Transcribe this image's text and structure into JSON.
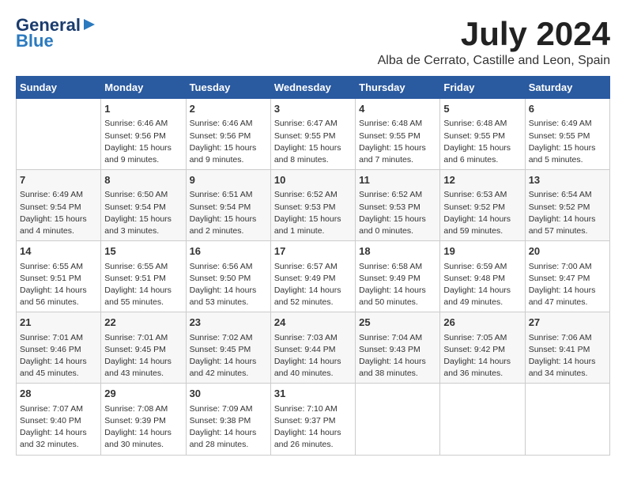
{
  "header": {
    "logo_line1": "General",
    "logo_line2": "Blue",
    "month_year": "July 2024",
    "location": "Alba de Cerrato, Castille and Leon, Spain"
  },
  "days_of_week": [
    "Sunday",
    "Monday",
    "Tuesday",
    "Wednesday",
    "Thursday",
    "Friday",
    "Saturday"
  ],
  "weeks": [
    [
      {
        "day": "",
        "content": ""
      },
      {
        "day": "1",
        "content": "Sunrise: 6:46 AM\nSunset: 9:56 PM\nDaylight: 15 hours\nand 9 minutes."
      },
      {
        "day": "2",
        "content": "Sunrise: 6:46 AM\nSunset: 9:56 PM\nDaylight: 15 hours\nand 9 minutes."
      },
      {
        "day": "3",
        "content": "Sunrise: 6:47 AM\nSunset: 9:55 PM\nDaylight: 15 hours\nand 8 minutes."
      },
      {
        "day": "4",
        "content": "Sunrise: 6:48 AM\nSunset: 9:55 PM\nDaylight: 15 hours\nand 7 minutes."
      },
      {
        "day": "5",
        "content": "Sunrise: 6:48 AM\nSunset: 9:55 PM\nDaylight: 15 hours\nand 6 minutes."
      },
      {
        "day": "6",
        "content": "Sunrise: 6:49 AM\nSunset: 9:55 PM\nDaylight: 15 hours\nand 5 minutes."
      }
    ],
    [
      {
        "day": "7",
        "content": "Sunrise: 6:49 AM\nSunset: 9:54 PM\nDaylight: 15 hours\nand 4 minutes."
      },
      {
        "day": "8",
        "content": "Sunrise: 6:50 AM\nSunset: 9:54 PM\nDaylight: 15 hours\nand 3 minutes."
      },
      {
        "day": "9",
        "content": "Sunrise: 6:51 AM\nSunset: 9:54 PM\nDaylight: 15 hours\nand 2 minutes."
      },
      {
        "day": "10",
        "content": "Sunrise: 6:52 AM\nSunset: 9:53 PM\nDaylight: 15 hours\nand 1 minute."
      },
      {
        "day": "11",
        "content": "Sunrise: 6:52 AM\nSunset: 9:53 PM\nDaylight: 15 hours\nand 0 minutes."
      },
      {
        "day": "12",
        "content": "Sunrise: 6:53 AM\nSunset: 9:52 PM\nDaylight: 14 hours\nand 59 minutes."
      },
      {
        "day": "13",
        "content": "Sunrise: 6:54 AM\nSunset: 9:52 PM\nDaylight: 14 hours\nand 57 minutes."
      }
    ],
    [
      {
        "day": "14",
        "content": "Sunrise: 6:55 AM\nSunset: 9:51 PM\nDaylight: 14 hours\nand 56 minutes."
      },
      {
        "day": "15",
        "content": "Sunrise: 6:55 AM\nSunset: 9:51 PM\nDaylight: 14 hours\nand 55 minutes."
      },
      {
        "day": "16",
        "content": "Sunrise: 6:56 AM\nSunset: 9:50 PM\nDaylight: 14 hours\nand 53 minutes."
      },
      {
        "day": "17",
        "content": "Sunrise: 6:57 AM\nSunset: 9:49 PM\nDaylight: 14 hours\nand 52 minutes."
      },
      {
        "day": "18",
        "content": "Sunrise: 6:58 AM\nSunset: 9:49 PM\nDaylight: 14 hours\nand 50 minutes."
      },
      {
        "day": "19",
        "content": "Sunrise: 6:59 AM\nSunset: 9:48 PM\nDaylight: 14 hours\nand 49 minutes."
      },
      {
        "day": "20",
        "content": "Sunrise: 7:00 AM\nSunset: 9:47 PM\nDaylight: 14 hours\nand 47 minutes."
      }
    ],
    [
      {
        "day": "21",
        "content": "Sunrise: 7:01 AM\nSunset: 9:46 PM\nDaylight: 14 hours\nand 45 minutes."
      },
      {
        "day": "22",
        "content": "Sunrise: 7:01 AM\nSunset: 9:45 PM\nDaylight: 14 hours\nand 43 minutes."
      },
      {
        "day": "23",
        "content": "Sunrise: 7:02 AM\nSunset: 9:45 PM\nDaylight: 14 hours\nand 42 minutes."
      },
      {
        "day": "24",
        "content": "Sunrise: 7:03 AM\nSunset: 9:44 PM\nDaylight: 14 hours\nand 40 minutes."
      },
      {
        "day": "25",
        "content": "Sunrise: 7:04 AM\nSunset: 9:43 PM\nDaylight: 14 hours\nand 38 minutes."
      },
      {
        "day": "26",
        "content": "Sunrise: 7:05 AM\nSunset: 9:42 PM\nDaylight: 14 hours\nand 36 minutes."
      },
      {
        "day": "27",
        "content": "Sunrise: 7:06 AM\nSunset: 9:41 PM\nDaylight: 14 hours\nand 34 minutes."
      }
    ],
    [
      {
        "day": "28",
        "content": "Sunrise: 7:07 AM\nSunset: 9:40 PM\nDaylight: 14 hours\nand 32 minutes."
      },
      {
        "day": "29",
        "content": "Sunrise: 7:08 AM\nSunset: 9:39 PM\nDaylight: 14 hours\nand 30 minutes."
      },
      {
        "day": "30",
        "content": "Sunrise: 7:09 AM\nSunset: 9:38 PM\nDaylight: 14 hours\nand 28 minutes."
      },
      {
        "day": "31",
        "content": "Sunrise: 7:10 AM\nSunset: 9:37 PM\nDaylight: 14 hours\nand 26 minutes."
      },
      {
        "day": "",
        "content": ""
      },
      {
        "day": "",
        "content": ""
      },
      {
        "day": "",
        "content": ""
      }
    ]
  ]
}
